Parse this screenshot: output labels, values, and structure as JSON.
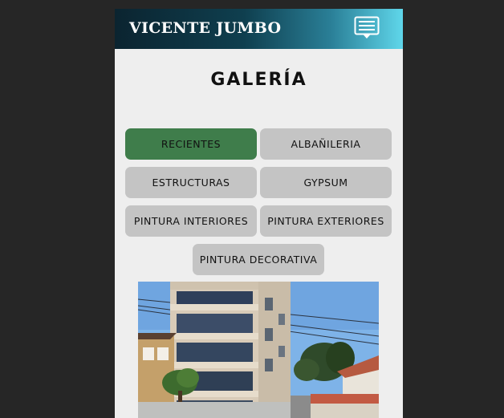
{
  "header": {
    "brand": "VICENTE JUMBO",
    "menu_icon": "message-menu-icon"
  },
  "page": {
    "title": "GALERÍA"
  },
  "filters": [
    {
      "label": "RECIENTES",
      "active": true
    },
    {
      "label": "ALBAÑILERIA",
      "active": false
    },
    {
      "label": "ESTRUCTURAS",
      "active": false
    },
    {
      "label": "GYPSUM",
      "active": false
    },
    {
      "label": "PINTURA INTERIORES",
      "active": false
    },
    {
      "label": "PINTURA EXTERIORES",
      "active": false
    },
    {
      "label": "PINTURA DECORATIVA",
      "active": false
    }
  ],
  "colors": {
    "active_filter": "#3f7d4b",
    "inactive_filter": "#c4c4c4",
    "page_background": "#eeeeee",
    "outer_background": "#262626"
  }
}
